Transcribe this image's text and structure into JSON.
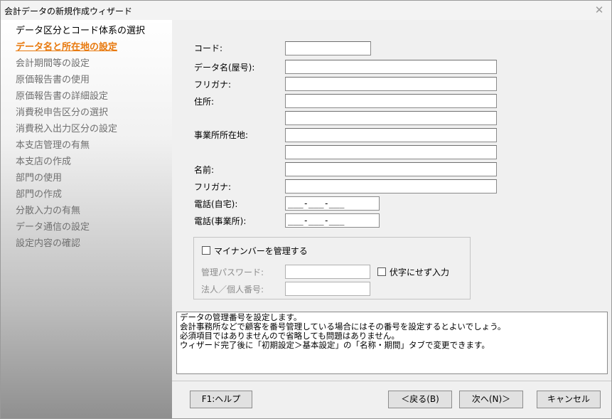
{
  "window": {
    "title": "会計データの新規作成ウィザード",
    "close_icon": "close-icon"
  },
  "steps": [
    {
      "label": "データ区分とコード体系の選択",
      "state": "done"
    },
    {
      "label": "データ名と所在地の設定",
      "state": "current"
    },
    {
      "label": "会計期間等の設定",
      "state": "pending"
    },
    {
      "label": "原価報告書の使用",
      "state": "pending"
    },
    {
      "label": "原価報告書の詳細設定",
      "state": "pending"
    },
    {
      "label": "消費税申告区分の選択",
      "state": "pending"
    },
    {
      "label": "消費税入出力区分の設定",
      "state": "pending"
    },
    {
      "label": "本支店管理の有無",
      "state": "pending"
    },
    {
      "label": "本支店の作成",
      "state": "pending"
    },
    {
      "label": "部門の使用",
      "state": "pending"
    },
    {
      "label": "部門の作成",
      "state": "pending"
    },
    {
      "label": "分散入力の有無",
      "state": "pending"
    },
    {
      "label": "データ通信の設定",
      "state": "pending"
    },
    {
      "label": "設定内容の確認",
      "state": "pending"
    }
  ],
  "form": {
    "code_label": "コード:",
    "code_value": "",
    "data_name_label": "データ名(屋号):",
    "data_name_value": "",
    "furigana_label": "フリガナ:",
    "furigana_value": "",
    "address_label": "住所:",
    "address_line1": "",
    "address_line2": "",
    "office_address_label": "事業所所在地:",
    "office_address_line1": "",
    "office_address_line2": "",
    "name_label": "名前:",
    "name_value": "",
    "name_furigana_label": "フリガナ:",
    "name_furigana_value": "",
    "phone_home_label": "電話(自宅):",
    "phone_home_mask": "___-___-___",
    "phone_office_label": "電話(事業所):",
    "phone_office_mask": "___-___-___"
  },
  "mynumber": {
    "manage_label": "マイナンバーを管理する",
    "manage_checked": false,
    "password_label": "管理パスワード:",
    "password_value": "",
    "hide_label": "伏字にせず入力",
    "hide_checked": false,
    "id_label": "法人／個人番号:",
    "id_value": ""
  },
  "help_text": [
    "データの管理番号を設定します。",
    "会計事務所などで顧客を番号管理している場合にはその番号を設定するとよいでしょう。",
    "必須項目ではありませんので省略しても問題はありません。",
    "ウィザード完了後に「初期設定＞基本設定」の「名称・期間」タブで変更できます。"
  ],
  "buttons": {
    "help": "F1:ヘルプ",
    "back": "＜戻る(B)",
    "next": "次へ(N)＞",
    "cancel": "キャンセル"
  }
}
